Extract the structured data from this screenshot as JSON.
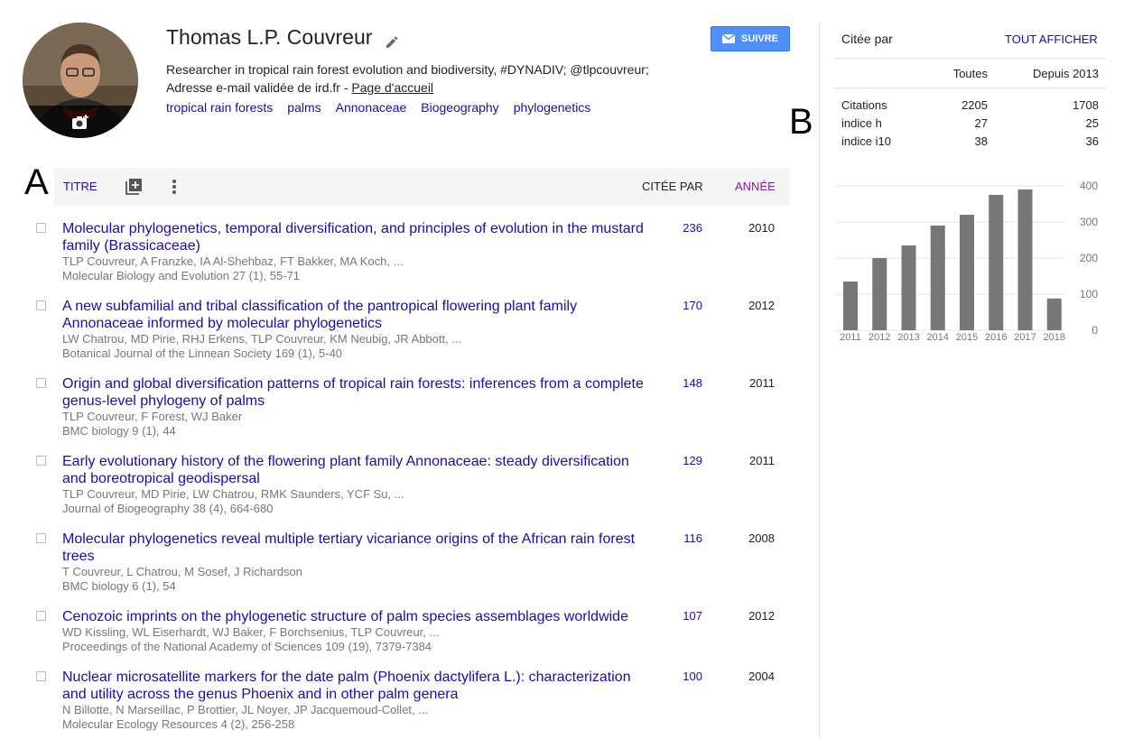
{
  "profile": {
    "name": "Thomas L.P. Couvreur",
    "affiliation": "Researcher in tropical rain forest evolution and biodiversity, #DYNADIV; @tlpcouvreur;",
    "email_text": "Adresse e-mail validée de ird.fr - ",
    "homepage_label": "Page d'accueil",
    "follow_label": "SUIVRE",
    "interests": [
      "tropical rain forests",
      "palms",
      "Annonaceae",
      "Biogeography",
      "phylogenetics"
    ]
  },
  "annotations": {
    "a": "A",
    "b": "B"
  },
  "table": {
    "col_title": "TITRE",
    "col_cited": "CITÉE PAR",
    "col_year": "ANNÉE"
  },
  "articles": [
    {
      "title": "Molecular phylogenetics, temporal diversification, and principles of evolution in the mustard family (Brassicaceae)",
      "authors": "TLP Couvreur, A Franzke, IA Al-Shehbaz, FT Bakker, MA Koch, ...",
      "venue": "Molecular Biology and Evolution 27 (1), 55-71",
      "cited": "236",
      "year": "2010"
    },
    {
      "title": "A new subfamilial and tribal classification of the pantropical flowering plant family Annonaceae informed by molecular phylogenetics",
      "authors": "LW Chatrou, MD Pirie, RHJ Erkens, TLP Couvreur, KM Neubig, JR Abbott, ...",
      "venue": "Botanical Journal of the Linnean Society 169 (1), 5-40",
      "cited": "170",
      "year": "2012"
    },
    {
      "title": "Origin and global diversification patterns of tropical rain forests: inferences from a complete genus-level phylogeny of palms",
      "authors": "TLP Couvreur, F Forest, WJ Baker",
      "venue": "BMC biology 9 (1), 44",
      "cited": "148",
      "year": "2011"
    },
    {
      "title": "Early evolutionary history of the flowering plant family Annonaceae: steady diversification and boreotropical geodispersal",
      "authors": "TLP Couvreur, MD Pirie, LW Chatrou, RMK Saunders, YCF Su, ...",
      "venue": "Journal of Biogeography 38 (4), 664-680",
      "cited": "129",
      "year": "2011"
    },
    {
      "title": "Molecular phylogenetics reveal multiple tertiary vicariance origins of the African rain forest trees",
      "authors": "T Couvreur, L Chatrou, M Sosef, J Richardson",
      "venue": "BMC biology 6 (1), 54",
      "cited": "116",
      "year": "2008"
    },
    {
      "title": "Cenozoic imprints on the phylogenetic structure of palm species assemblages worldwide",
      "authors": "WD Kissling, WL Eiserhardt, WJ Baker, F Borchsenius, TLP Couvreur, ...",
      "venue": "Proceedings of the National Academy of Sciences 109 (19), 7379-7384",
      "cited": "107",
      "year": "2012"
    },
    {
      "title": "Nuclear microsatellite markers for the date palm (Phoenix dactylifera L.): characterization and utility across the genus Phoenix and in other palm genera",
      "authors": "N Billotte, N Marseillac, P Brottier, JL Noyer, JP Jacquemoud-Collet, ...",
      "venue": "Molecular Ecology Resources 4 (2), 256-258",
      "cited": "100",
      "year": "2004"
    }
  ],
  "cited_by": {
    "title": "Citée par",
    "show_all": "TOUT AFFICHER",
    "col_all": "Toutes",
    "col_since": "Depuis 2013",
    "rows": [
      {
        "label": "Citations",
        "all": "2205",
        "since": "1708"
      },
      {
        "label": "indice h",
        "all": "27",
        "since": "25"
      },
      {
        "label": "indice i10",
        "all": "38",
        "since": "36"
      }
    ]
  },
  "chart_data": {
    "type": "bar",
    "categories": [
      "2011",
      "2012",
      "2013",
      "2014",
      "2015",
      "2016",
      "2017",
      "2018"
    ],
    "values": [
      135,
      200,
      235,
      290,
      320,
      375,
      390,
      88
    ],
    "yticks": [
      400,
      300,
      200,
      100,
      0
    ],
    "ylim": [
      0,
      400
    ],
    "grid": true,
    "bar_color": "#777777"
  },
  "colors": {
    "link": "#1a0dab",
    "follow": "#4d90fe",
    "year_header": "#7e1fa0"
  }
}
